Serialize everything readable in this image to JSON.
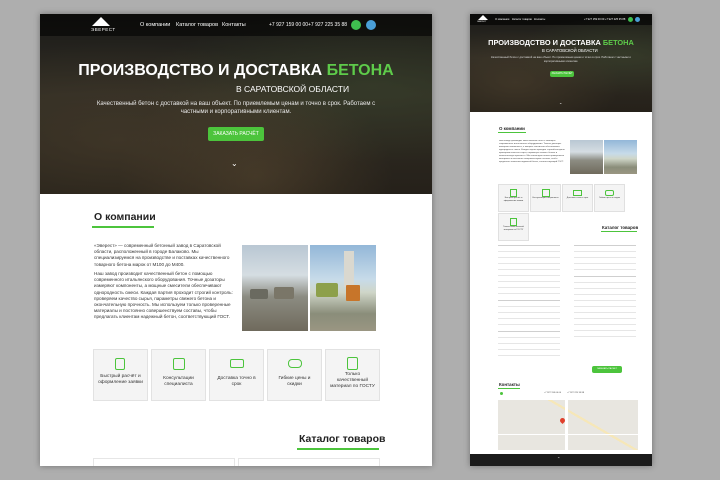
{
  "brand": {
    "logo_text": "ЭВЕРЕСТ",
    "accent": "#4cc43c"
  },
  "nav": {
    "items": [
      "О компании",
      "Каталог товаров",
      "Контакты"
    ],
    "phone1": "+7 927 159 00 00",
    "phone2": "+7 927 225 35 88",
    "icons": [
      "whatsapp-icon",
      "telegram-icon"
    ]
  },
  "hero": {
    "title_main": "ПРОИЗВОДСТВО И ДОСТАВКА ",
    "title_accent": "БЕТОНА",
    "subtitle": "В САРАТОВСКОЙ ОБЛАСТИ",
    "lead": "Качественный бетон с доставкой на ваш объект. По приемлемым ценам и точно в срок. Работаем с частными и корпоративными клиентам.",
    "cta": "ЗАКАЗАТЬ РАСЧЁТ",
    "scroll_icon": "chevron-down-icon"
  },
  "about": {
    "title": "О компании",
    "p1": "«Эверест» — современный бетонный завод в Саратовской области, расположенный в городе Балаково. Мы специализируемся на производстве и поставках качественного товарного бетона марок от М100 до М400.",
    "p2": "Наш завод производит качественный бетон с помощью современного итальянского оборудования. Точные дозаторы измеряют компоненты, а мощные смесители обеспечивают однородность смеси. Каждая партия проходит строгий контроль: проверяем качество сырья, параметры свежего бетона и окончательную прочность. Мы используем только проверенные материалы и постоянно совершенствуем составы, чтобы предлагать клиентам надежный бетон, соответствующий ГОСТ."
  },
  "features": [
    {
      "icon": "calculator-icon",
      "label": "Быстрый расчёт и оформление заявки"
    },
    {
      "icon": "consultant-icon",
      "label": "Консультации специалиста"
    },
    {
      "icon": "truck-icon",
      "label": "Доставка точно в срок"
    },
    {
      "icon": "handshake-icon",
      "label": "Гибкие цены и скидки"
    },
    {
      "icon": "certificate-icon",
      "label": "Только качественный материал по ГОСТУ"
    }
  ],
  "catalog": {
    "title": "Каталог товаров"
  },
  "contacts": {
    "title": "Контакты"
  }
}
